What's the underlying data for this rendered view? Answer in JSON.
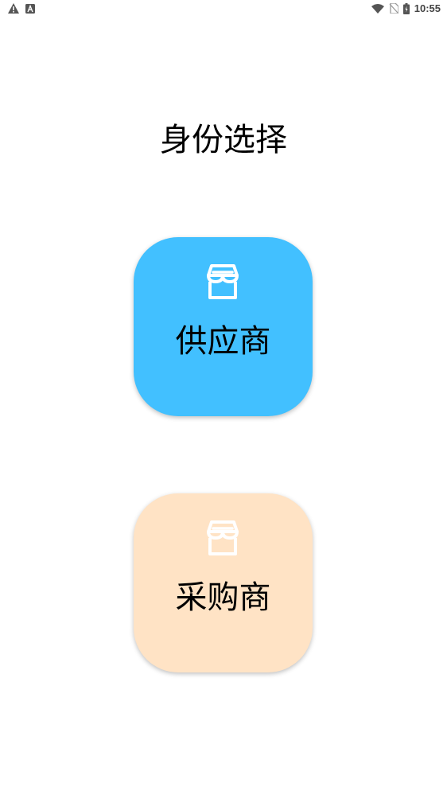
{
  "status_bar": {
    "time": "10:55",
    "left_icons": [
      "warning-icon",
      "font-a-icon"
    ],
    "right_icons": [
      "wifi-icon",
      "no-sim-icon",
      "battery-charging-icon"
    ]
  },
  "page": {
    "title": "身份选择"
  },
  "roles": [
    {
      "label": "供应商",
      "icon": "storefront-icon",
      "color": "#42C0FF"
    },
    {
      "label": "采购商",
      "icon": "storefront-icon",
      "color": "#FFE3C5"
    }
  ]
}
